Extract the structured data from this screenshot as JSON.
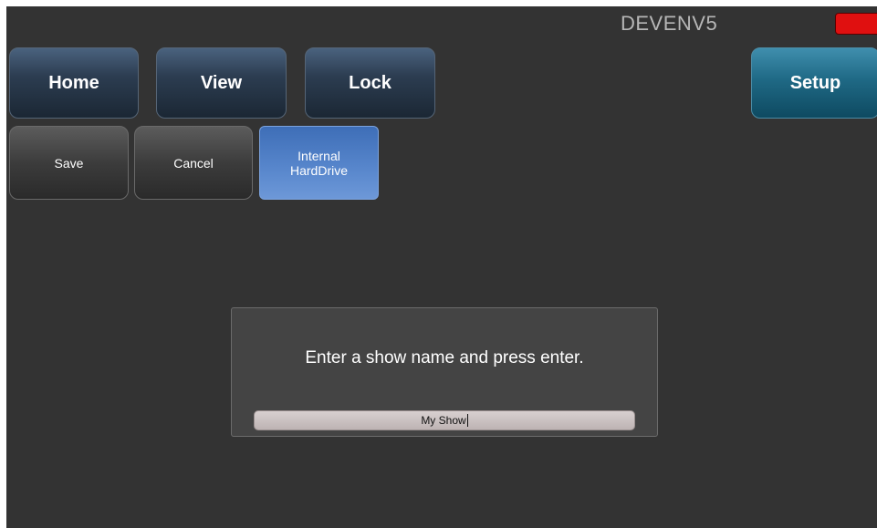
{
  "header": {
    "device_name": "DEVENV5",
    "status_color": "#e01010"
  },
  "nav": {
    "home_label": "Home",
    "view_label": "View",
    "lock_label": "Lock",
    "setup_label": "Setup"
  },
  "actions": {
    "save_label": "Save",
    "cancel_label": "Cancel",
    "drive_label": "Internal\nHardDrive"
  },
  "dialog": {
    "message": "Enter a show name and press enter.",
    "input_value": "My Show"
  },
  "colors": {
    "background": "#333333",
    "nav_button": "#2c3d51",
    "setup_button": "#1f6985",
    "selected_button": "#5685cb"
  }
}
